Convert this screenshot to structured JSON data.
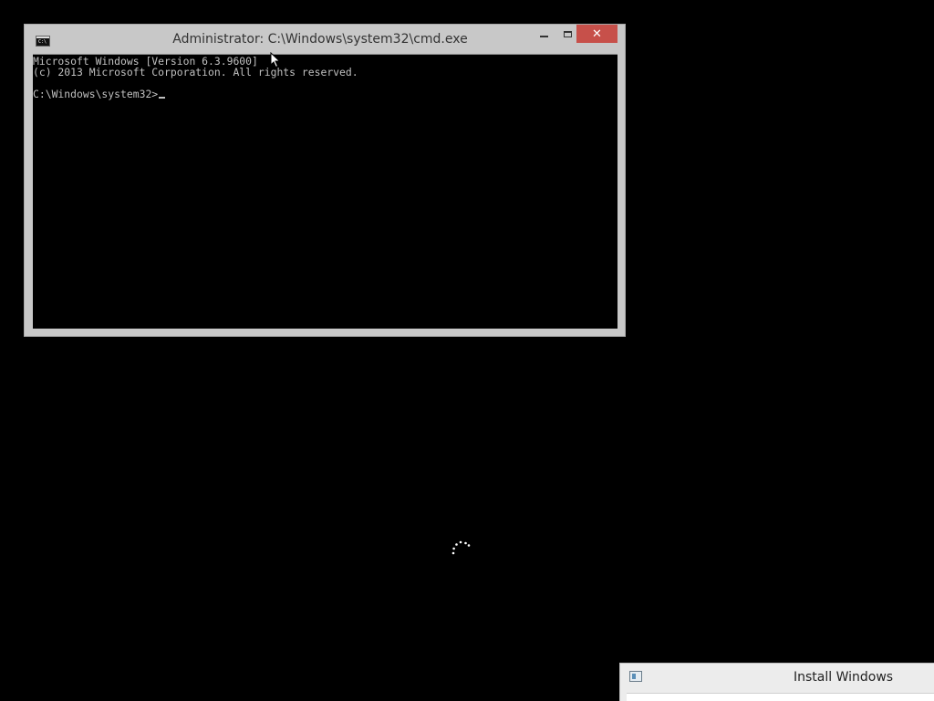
{
  "cmd_window": {
    "title": "Administrator: C:\\Windows\\system32\\cmd.exe",
    "icon": "cmd-icon",
    "icon_text": "C:\\",
    "close_glyph": "✕",
    "console_lines": [
      "Microsoft Windows [Version 6.3.9600]",
      "(c) 2013 Microsoft Corporation. All rights reserved.",
      "",
      "C:\\Windows\\system32>"
    ]
  },
  "install_window": {
    "title": "Install Windows",
    "icon": "install-windows-icon"
  },
  "colors": {
    "desktop_bg": "#000000",
    "window_frame": "#c8c8c8",
    "close_button": "#c7504a",
    "console_text": "#c0c0c0"
  }
}
